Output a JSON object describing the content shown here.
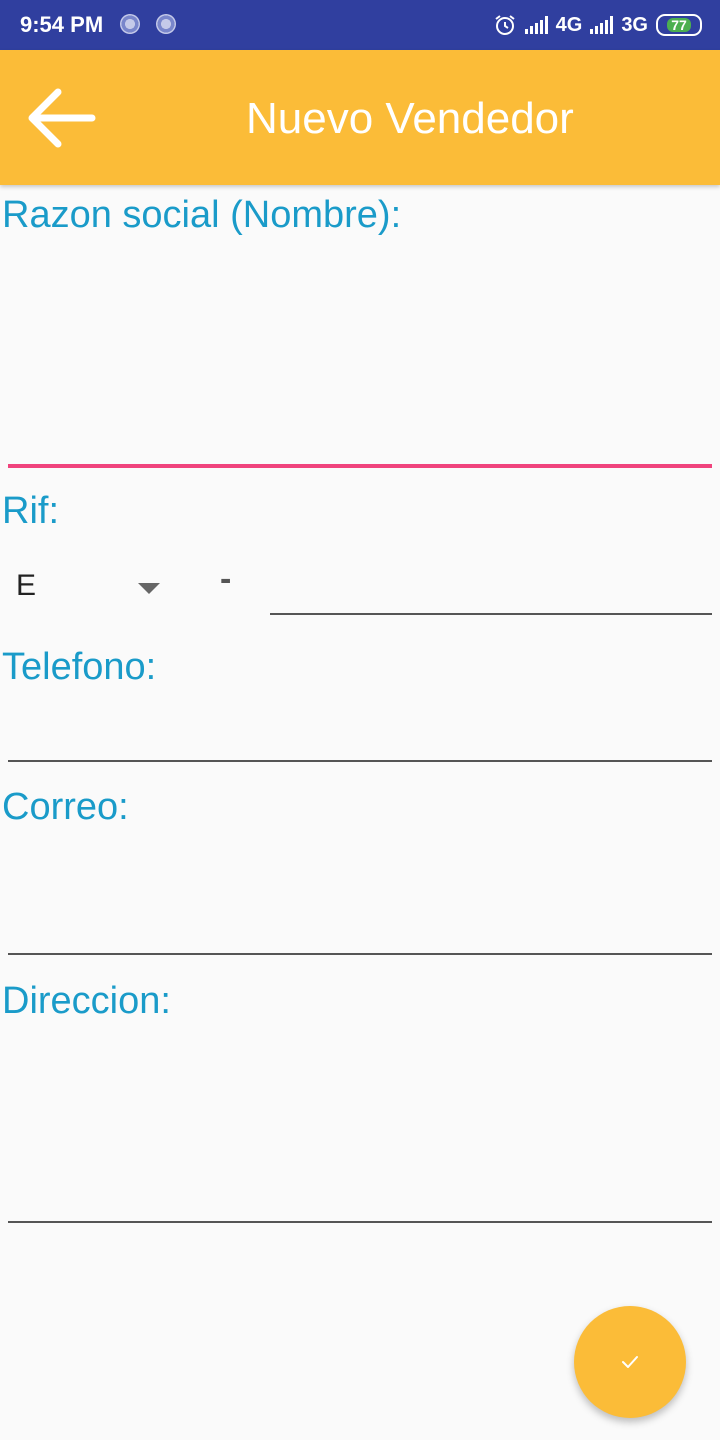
{
  "status_bar": {
    "time": "9:54 PM",
    "network_1": "4G",
    "network_2": "3G",
    "battery": "77"
  },
  "app_bar": {
    "title": "Nuevo Vendedor",
    "back_icon": "arrow-back-icon",
    "color": "#fbbc38"
  },
  "form": {
    "razon_social_label": "Razon social (Nombre):",
    "razon_social_value": "",
    "rif_label": "Rif:",
    "rif_type_value": "E",
    "rif_separator": "-",
    "rif_number_value": "",
    "telefono_label": "Telefono:",
    "telefono_value": "",
    "correo_label": "Correo:",
    "correo_value": "",
    "direccion_label": "Direccion:",
    "direccion_value": ""
  },
  "fab": {
    "icon": "check-icon"
  },
  "colors": {
    "primary_dark": "#303f9f",
    "accent": "#f0437d",
    "label": "#1a9bc9"
  }
}
